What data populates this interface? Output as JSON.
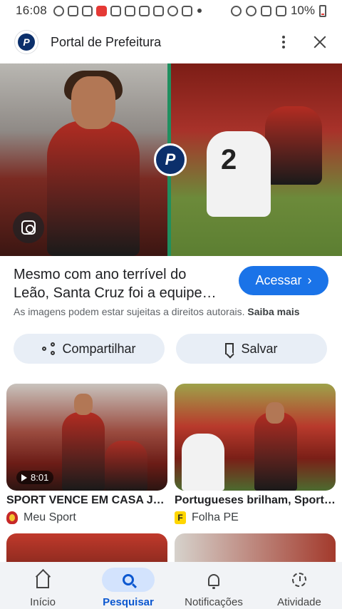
{
  "status_bar": {
    "time": "16:08",
    "battery": "10%"
  },
  "header": {
    "logo_letter": "P",
    "title": "Portal de Prefeitura"
  },
  "hero": {
    "jersey_number": "2",
    "overlay_logo_letter": "P"
  },
  "result": {
    "headline": "Mesmo com ano terrível do Leão, Santa Cruz foi a equipe…",
    "access_label": "Acessar",
    "copyright_text": "As imagens podem estar sujeitas a direitos autorais.",
    "learn_more": "Saiba mais"
  },
  "actions": {
    "share_label": "Compartilhar",
    "save_label": "Salvar"
  },
  "related": [
    {
      "title": "SPORT VENCE EM CASA JOG…",
      "source": "Meu Sport",
      "duration": "8:01"
    },
    {
      "title": "Portugueses brilham, Sport…",
      "source": "Folha PE",
      "source_icon_letter": "F"
    }
  ],
  "bottom_nav": {
    "items": [
      {
        "label": "Início"
      },
      {
        "label": "Pesquisar"
      },
      {
        "label": "Notificações"
      },
      {
        "label": "Atividade"
      }
    ]
  },
  "colors": {
    "accent": "#1a73e8",
    "nav_active": "#0b57d0",
    "chip_bg": "#e8eef6"
  }
}
